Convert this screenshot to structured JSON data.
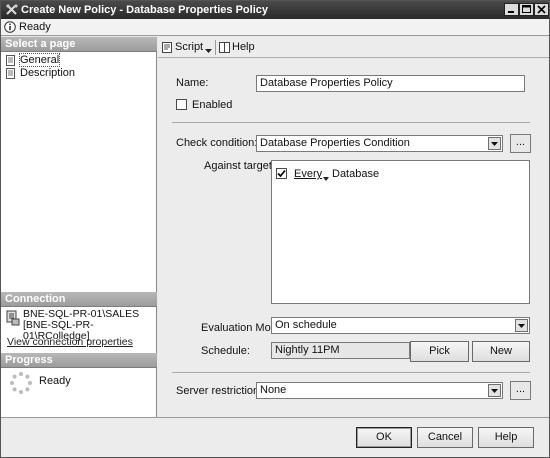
{
  "window": {
    "title": "Create New Policy - Database Properties Policy",
    "status": "Ready"
  },
  "left": {
    "select_page_header": "Select a page",
    "pages": [
      {
        "label": "General",
        "selected": true
      },
      {
        "label": "Description",
        "selected": false
      }
    ],
    "connection_header": "Connection",
    "connection_server": "BNE-SQL-PR-01\\SALES",
    "connection_user": "[BNE-SQL-PR-01\\RColledge]",
    "connection_link": "View connection properties",
    "progress_header": "Progress",
    "progress_status": "Ready"
  },
  "toolbar": {
    "script_label": "Script",
    "help_label": "Help"
  },
  "form": {
    "name_label": "Name:",
    "name_value": "Database Properties Policy",
    "enabled_label": "Enabled",
    "enabled_checked": false,
    "check_condition_label": "Check condition:",
    "check_condition_value": "Database Properties Condition",
    "ellipsis_label": "...",
    "against_targets_label": "Against targets:",
    "target": {
      "checked": true,
      "qualifier": "Every",
      "object": "Database"
    },
    "evaluation_mode_label": "Evaluation Mode:",
    "evaluation_mode_value": "On schedule",
    "schedule_label": "Schedule:",
    "schedule_value": "Nightly 11PM",
    "pick_label": "Pick",
    "new_label": "New",
    "server_restriction_label": "Server restriction:",
    "server_restriction_value": "None"
  },
  "buttons": {
    "ok": "OK",
    "cancel": "Cancel",
    "help": "Help"
  }
}
